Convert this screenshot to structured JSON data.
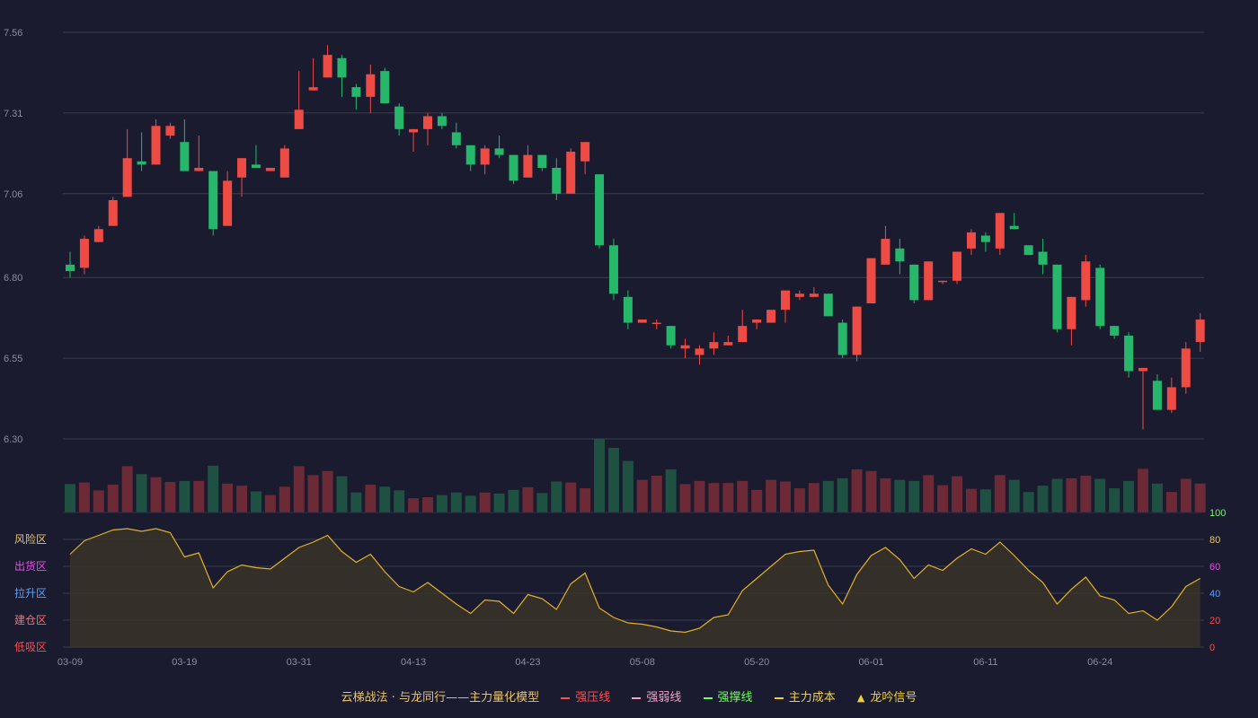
{
  "legend": {
    "title": "云梯战法 · 与龙同行——主力量化模型",
    "title_color": "#e8c26a",
    "items": [
      {
        "label": "强压线",
        "color": "#ff4d4d",
        "style": "solid"
      },
      {
        "label": "强弱线",
        "color": "#ff9ec7",
        "style": "dashed"
      },
      {
        "label": "强撑线",
        "color": "#6dff5a",
        "style": "solid"
      },
      {
        "label": "主力成本",
        "color": "#f2cf3a",
        "style": "dashed"
      },
      {
        "label": "龙吟信号",
        "color": "#f2cf3a",
        "style": "triangle"
      }
    ]
  },
  "chart_data": [
    {
      "type": "candlestick",
      "y_ticks": [
        "6.30",
        "6.55",
        "6.80",
        "7.06",
        "7.31",
        "7.56"
      ],
      "ylim": [
        6.3,
        7.56
      ],
      "x_ticks": [
        {
          "index": 0,
          "label": "03-09"
        },
        {
          "index": 8,
          "label": "03-19"
        },
        {
          "index": 16,
          "label": "03-31"
        },
        {
          "index": 24,
          "label": "04-13"
        },
        {
          "index": 32,
          "label": "04-23"
        },
        {
          "index": 40,
          "label": "05-08"
        },
        {
          "index": 48,
          "label": "05-20"
        },
        {
          "index": 56,
          "label": "06-01"
        },
        {
          "index": 64,
          "label": "06-11"
        },
        {
          "index": 72,
          "label": "06-24"
        }
      ],
      "up_color": "#ef4b45",
      "down_color": "#26b76b",
      "ohlc": [
        [
          6.84,
          6.88,
          6.8,
          6.82
        ],
        [
          6.83,
          6.93,
          6.81,
          6.92
        ],
        [
          6.91,
          6.96,
          6.91,
          6.95
        ],
        [
          6.96,
          7.05,
          6.96,
          7.04
        ],
        [
          7.05,
          7.26,
          7.05,
          7.17
        ],
        [
          7.16,
          7.25,
          7.13,
          7.15
        ],
        [
          7.15,
          7.29,
          7.15,
          7.27
        ],
        [
          7.24,
          7.28,
          7.23,
          7.27
        ],
        [
          7.22,
          7.29,
          7.14,
          7.13
        ],
        [
          7.13,
          7.24,
          7.13,
          7.14
        ],
        [
          7.13,
          7.13,
          6.93,
          6.95
        ],
        [
          6.96,
          7.13,
          6.96,
          7.1
        ],
        [
          7.11,
          7.16,
          7.05,
          7.17
        ],
        [
          7.15,
          7.21,
          7.16,
          7.14
        ],
        [
          7.13,
          7.14,
          7.14,
          7.14
        ],
        [
          7.11,
          7.21,
          7.11,
          7.2
        ],
        [
          7.26,
          7.44,
          7.26,
          7.32
        ],
        [
          7.38,
          7.48,
          7.4,
          7.39
        ],
        [
          7.42,
          7.52,
          7.42,
          7.49
        ],
        [
          7.48,
          7.49,
          7.36,
          7.42
        ],
        [
          7.39,
          7.4,
          7.32,
          7.36
        ],
        [
          7.36,
          7.46,
          7.31,
          7.43
        ],
        [
          7.44,
          7.45,
          7.35,
          7.34
        ],
        [
          7.33,
          7.34,
          7.24,
          7.26
        ],
        [
          7.25,
          7.26,
          7.19,
          7.26
        ],
        [
          7.26,
          7.31,
          7.21,
          7.3
        ],
        [
          7.3,
          7.31,
          7.26,
          7.27
        ],
        [
          7.25,
          7.28,
          7.2,
          7.21
        ],
        [
          7.21,
          7.21,
          7.13,
          7.15
        ],
        [
          7.15,
          7.21,
          7.12,
          7.2
        ],
        [
          7.2,
          7.24,
          7.17,
          7.18
        ],
        [
          7.18,
          7.18,
          7.09,
          7.1
        ],
        [
          7.11,
          7.21,
          7.11,
          7.18
        ],
        [
          7.18,
          7.18,
          7.13,
          7.14
        ],
        [
          7.14,
          7.17,
          7.04,
          7.06
        ],
        [
          7.06,
          7.2,
          7.06,
          7.19
        ],
        [
          7.16,
          7.22,
          7.12,
          7.22
        ],
        [
          7.12,
          7.12,
          6.89,
          6.9
        ],
        [
          6.9,
          6.92,
          6.73,
          6.75
        ],
        [
          6.74,
          6.76,
          6.64,
          6.66
        ],
        [
          6.66,
          6.66,
          6.66,
          6.67
        ],
        [
          6.66,
          6.67,
          6.64,
          6.66
        ],
        [
          6.65,
          6.65,
          6.58,
          6.59
        ],
        [
          6.58,
          6.61,
          6.55,
          6.59
        ],
        [
          6.56,
          6.59,
          6.53,
          6.58
        ],
        [
          6.58,
          6.63,
          6.56,
          6.6
        ],
        [
          6.59,
          6.62,
          6.59,
          6.6
        ],
        [
          6.6,
          6.7,
          6.61,
          6.65
        ],
        [
          6.66,
          6.67,
          6.64,
          6.67
        ],
        [
          6.66,
          6.7,
          6.68,
          6.7
        ],
        [
          6.7,
          6.74,
          6.66,
          6.76
        ],
        [
          6.74,
          6.76,
          6.73,
          6.75
        ],
        [
          6.74,
          6.77,
          6.74,
          6.75
        ],
        [
          6.75,
          6.75,
          6.68,
          6.68
        ],
        [
          6.66,
          6.67,
          6.55,
          6.56
        ],
        [
          6.56,
          6.7,
          6.54,
          6.71
        ],
        [
          6.72,
          6.86,
          6.72,
          6.86
        ],
        [
          6.84,
          6.96,
          6.84,
          6.92
        ],
        [
          6.89,
          6.92,
          6.81,
          6.85
        ],
        [
          6.84,
          6.84,
          6.72,
          6.73
        ],
        [
          6.73,
          6.84,
          6.73,
          6.85
        ],
        [
          6.79,
          6.79,
          6.78,
          6.79
        ],
        [
          6.79,
          6.87,
          6.78,
          6.88
        ],
        [
          6.89,
          6.95,
          6.87,
          6.94
        ],
        [
          6.93,
          6.94,
          6.88,
          6.91
        ],
        [
          6.89,
          6.99,
          6.87,
          7.0
        ],
        [
          6.96,
          7.0,
          6.96,
          6.95
        ],
        [
          6.9,
          6.9,
          6.87,
          6.87
        ],
        [
          6.88,
          6.92,
          6.81,
          6.84
        ],
        [
          6.84,
          6.84,
          6.63,
          6.64
        ],
        [
          6.64,
          6.73,
          6.59,
          6.74
        ],
        [
          6.73,
          6.87,
          6.71,
          6.85
        ],
        [
          6.83,
          6.84,
          6.64,
          6.65
        ],
        [
          6.65,
          6.63,
          6.61,
          6.62
        ],
        [
          6.62,
          6.63,
          6.49,
          6.51
        ],
        [
          6.51,
          6.52,
          6.33,
          6.52
        ],
        [
          6.48,
          6.5,
          6.39,
          6.39
        ],
        [
          6.39,
          6.49,
          6.38,
          6.46
        ],
        [
          6.46,
          6.6,
          6.44,
          6.58
        ],
        [
          6.6,
          6.69,
          6.57,
          6.67
        ]
      ],
      "volume": [
        54,
        57,
        42,
        53,
        88,
        73,
        67,
        58,
        60,
        60,
        89,
        55,
        51,
        40,
        33,
        49,
        88,
        71,
        79,
        69,
        38,
        53,
        49,
        42,
        27,
        29,
        33,
        38,
        32,
        38,
        36,
        43,
        48,
        37,
        59,
        57,
        46,
        140,
        123,
        98,
        62,
        70,
        82,
        54,
        60,
        56,
        56,
        60,
        43,
        62,
        59,
        46,
        56,
        60,
        65,
        82,
        79,
        65,
        62,
        60,
        71,
        52,
        69,
        45,
        44,
        71,
        62,
        39,
        51,
        64,
        65,
        70,
        64,
        46,
        60,
        83,
        55,
        39,
        64,
        55
      ]
    },
    {
      "type": "area",
      "y_ticks": [
        "0",
        "20",
        "40",
        "60",
        "80",
        "100"
      ],
      "y_tick_colors": [
        "#ff4d4d",
        "#ff4d4d",
        "#5aa0ff",
        "#e84de8",
        "#e8c26a",
        "#6dff5a"
      ],
      "ylim": [
        0,
        100
      ],
      "zones": [
        {
          "label": "风险区",
          "value": 80,
          "color": "#e8c26a"
        },
        {
          "label": "出货区",
          "value": 60,
          "color": "#e84de8"
        },
        {
          "label": "拉升区",
          "value": 40,
          "color": "#5aa0ff"
        },
        {
          "label": "建仓区",
          "value": 20,
          "color": "#ff6b6b"
        },
        {
          "label": "低吸区",
          "value": 0,
          "color": "#ff4d4d"
        }
      ],
      "line_color": "#e0b12a",
      "values": [
        69,
        79,
        83,
        87,
        88,
        86,
        88,
        85,
        67,
        70,
        44,
        56,
        61,
        59,
        58,
        66,
        74,
        78,
        83,
        71,
        63,
        69,
        56,
        45,
        41,
        48,
        40,
        32,
        25,
        35,
        34,
        25,
        39,
        36,
        28,
        47,
        55,
        29,
        22,
        18,
        17,
        15,
        12,
        11,
        14,
        22,
        24,
        42,
        51,
        60,
        69,
        71,
        72,
        46,
        32,
        54,
        68,
        74,
        65,
        51,
        61,
        57,
        66,
        73,
        69,
        78,
        68,
        57,
        48,
        32,
        43,
        52,
        38,
        35,
        25,
        27,
        20,
        30,
        45,
        51
      ]
    }
  ]
}
